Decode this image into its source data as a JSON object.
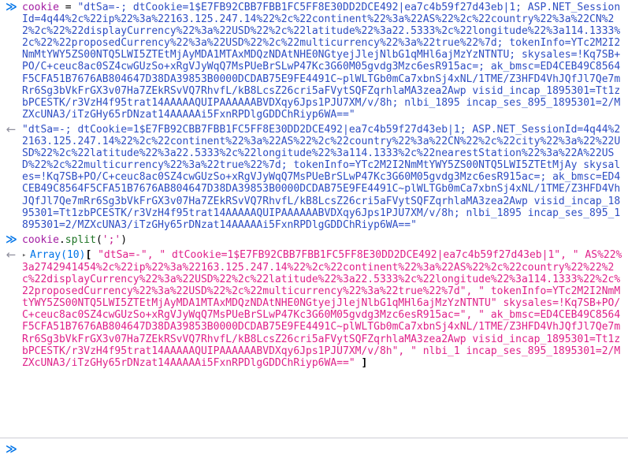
{
  "console": {
    "prompt_marker": "≫",
    "output_marker": "←",
    "twisty_glyph": "▸",
    "colors": {
      "input_chevron": "#0074e8",
      "output_chevron": "#8f8f9d",
      "variable": "#a21ca2",
      "property": "#1d7324",
      "string_literal": "#2e4ec4",
      "string_argument": "#c41a8d",
      "result_string": "#e0218a",
      "result_object": "#0074e8",
      "background": "#ffffff",
      "separator": "#cdcdd5"
    },
    "entries": [
      {
        "kind": "input",
        "tokens": [
          {
            "type": "variable",
            "text": "cookie"
          },
          {
            "type": "operator",
            "text": " = "
          },
          {
            "type": "string",
            "text": "\"dtSa=-; dtCookie=1$E7FB92CBB7FBB1FC5FF8E30DD2DCE492|ea7c4b59f27d43eb|1; ASP.NET_SessionId=4q44%2c%22ip%22%3a%22163.125.247.14%22%2c%22continent%22%3a%22AS%22%2c%22country%22%3a%22CN%22%2c%22%22displayCurrency%22%3a%22USD%22%2c%22latitude%22%3a22.5333%2c%22longitude%22%3a114.1333%2c%22%22proposedCurrency%22%3a%22USD%22%2c%22multicurrency%22%3a%22true%22%7d; tokenInfo=YTc2M2I2NmMtYWY5ZS00NTQ5LWI5ZTEtMjAyMDA1MTAxMDQzNDAtNHE0NGtyejJlejNlbG1qMHl6ajMzYzNTNTU; skysales=!Kq7SB+PO/C+ceuc8ac0SZ4cwGUzSo+xRgVJyWqQ7MsPUeBrSLwP47Kc3G60M05gvdg3Mzc6esR915ac=; ak_bmsc=ED4CEB49C8564F5CFA51B7676AB804647D38DA39853B0000DCDAB75E9FE4491C~plWLTGb0mCa7xbnSj4xNL/1TME/Z3HFD4VhJQfJl7Qe7mRr6Sg3bVkFrGX3v07Ha7ZEkRSvVQ7RhvfL/kB8LcsZ26cri5aFVytSQFZqrhlaMA3zea2Awp visid_incap_1895301=Tt1zbPCESTK/r3VzH4f95trat14AAAAAQUIPAAAAAABVDXqy6Jps1PJU7XM/v/8h; nlbi_1895 incap_ses_895_1895301=2/MZXcUNA3/iTzGHy65rDNzat14AAAAAi5FxnRPDlgGDDChRiyp6WA==\""
          }
        ]
      },
      {
        "kind": "output",
        "value_type": "string",
        "text": "\"dtSa=-; dtCookie=1$E7FB92CBB7FBB1FC5FF8E30DD2DCE492|ea7c4b59f27d43eb|1; ASP.NET_SessionId=4q44%22163.125.247.14%22%2c%22continent%22%3a%22AS%22%2c%22country%22%3a%22CN%22%2c%22city%22%3a%22%22USD%22%2c%22latitude%22%3a22.5333%2c%22longitude%22%3a114.1333%2c%22nearestStation%22%3a%22A%22USD%22%2c%22multicurrency%22%3a%22true%22%7d; tokenInfo=YTc2M2I2NmMtYWY5ZS00NTQ5LWI5ZTEtMjAy skysales=!Kq7SB+PO/C+ceuc8ac0SZ4cwGUzSo+xRgVJyWqQ7MsPUeBrSLwP47Kc3G60M05gvdg3Mzc6esR915ac=; ak_bmsc=ED4CEB49C8564F5CFA51B7676AB804647D38DA39853B0000DCDAB75E9FE4491C~plWLTGb0mCa7xbnSj4xNL/1TME/Z3HFD4VhJQfJl7Qe7mRr6Sg3bVkFrGX3v07Ha7ZEkRSvVQ7RhvfL/kB8LcsZ26cri5aFVytSQFZqrhlaMA3zea2Awp visid_incap_1895301=Tt1zbPCESTK/r3VzH4f95trat14AAAAAQUIPAAAAAABVDXqy6Jps1PJU7XM/v/8h; nlbi_1895 incap_ses_895_1895301=2/MZXcUNA3/iTzGHy65rDNzat14AAAAAi5FxnRPDlgGDDChRiyp6WA==\""
      },
      {
        "kind": "input",
        "tokens": [
          {
            "type": "variable",
            "text": "cookie"
          },
          {
            "type": "punct",
            "text": "."
          },
          {
            "type": "property",
            "text": "split"
          },
          {
            "type": "punct",
            "text": "("
          },
          {
            "type": "argument",
            "text": "';'"
          },
          {
            "type": "punct",
            "text": ")"
          }
        ]
      },
      {
        "kind": "output",
        "value_type": "array",
        "label": "Array(10)",
        "open_bracket": "[",
        "close_bracket": "]",
        "items_text": "\"dtSa=-\", \" dtCookie=1$E7FB92CBB7FBB1FC5FF8E30DD2DCE492|ea7c4b59f27d43eb|1\", \" AS%22%3a2742941454%2c%22ip%22%3a%22163.125.247.14%22%2c%22continent%22%3a%22AS%22%2c%22country%22%22%2c%22displayCurrency%22%3a%22USD%22%2c%22latitude%22%3a22.5333%2c%22longitude%22%3a114.1333%22%2c%22proposedCurrency%22%3a%22USD%22%2c%22multicurrency%22%3a%22true%22%7d\", \" tokenInfo=YTc2M2I2NmMtYWY5ZS00NTQ5LWI5ZTEtMjAyMDA1MTAxMDQzNDAtNHE0NGtyejJlejNlbG1qMHl6ajMzYzNTNTU\" skysales=!Kq7SB+PO/C+ceuc8ac0SZ4cwGUzSo+xRgVJyWqQ7MsPUeBrSLwP47Kc3G60M05gvdg3Mzc6esR915ac=\", \" ak_bmsc=ED4CEB49C8564F5CFA51B7676AB804647D38DA39853B0000DCDAB75E9FE4491C~plWLTGb0mCa7xbnSj4xNL/1TME/Z3HFD4VhJQfJl7Qe7mRr6Sg3bVkFrGX3v07Ha7ZEkRSvVQ7RhvfL/kB8LcsZ26cri5aFVytSQFZqrhlaMA3zea2Awp visid_incap_1895301=Tt1zbPCESTK/r3VzH4f95trat14AAAAAQUIPAAAAAABVDXqy6Jps1PJU7XM/v/8h\", \" nlbi_1 incap_ses_895_1895301=2/MZXcUNA3/iTzGHy65rDNzat14AAAAAi5FxnRPDlgGDDChRiyp6WA==\""
      }
    ],
    "eval_prompt": {
      "value": "",
      "placeholder": ""
    }
  }
}
